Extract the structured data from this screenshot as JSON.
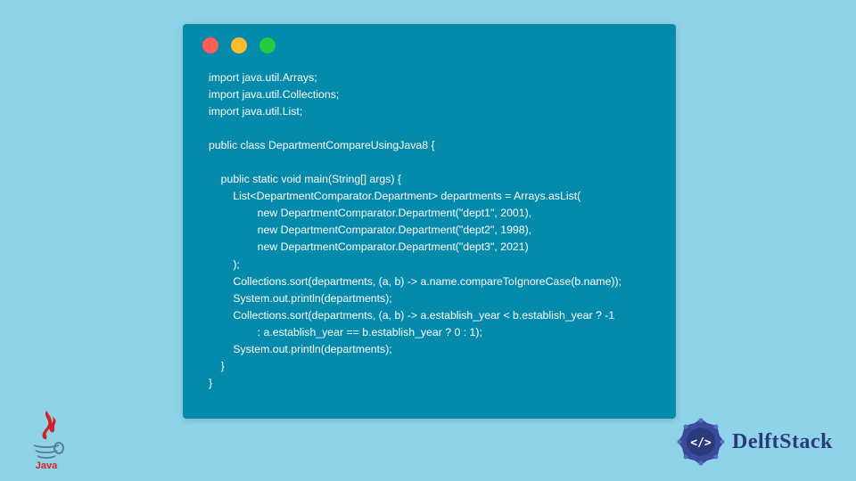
{
  "code": {
    "lines": [
      "import java.util.Arrays;",
      "import java.util.Collections;",
      "import java.util.List;",
      "",
      "public class DepartmentCompareUsingJava8 {",
      "",
      "    public static void main(String[] args) {",
      "        List<DepartmentComparator.Department> departments = Arrays.asList(",
      "                new DepartmentComparator.Department(\"dept1\", 2001),",
      "                new DepartmentComparator.Department(\"dept2\", 1998),",
      "                new DepartmentComparator.Department(\"dept3\", 2021)",
      "        );",
      "        Collections.sort(departments, (a, b) -> a.name.compareToIgnoreCase(b.name));",
      "        System.out.println(departments);",
      "        Collections.sort(departments, (a, b) -> a.establish_year < b.establish_year ? -1",
      "                : a.establish_year == b.establish_year ? 0 : 1);",
      "        System.out.println(departments);",
      "    }",
      "}"
    ]
  },
  "branding": {
    "java_label": "Java",
    "delft_label": "DelftStack"
  },
  "colors": {
    "page_bg": "#8ed3e8",
    "window_bg": "#068aab",
    "red": "#ff5f56",
    "yellow": "#ffbd2e",
    "green": "#27c93f",
    "delft_text": "#2b3a7a",
    "java_red": "#d22128",
    "java_blue": "#5382a1"
  }
}
